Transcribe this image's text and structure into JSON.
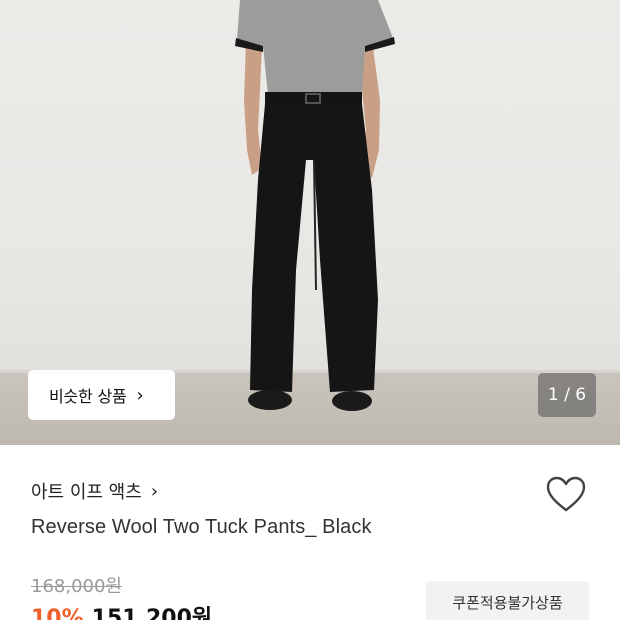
{
  "gallery": {
    "similar_button_label": "비슷한 상품",
    "page_indicator": "1 / 6"
  },
  "product": {
    "brand": "아트 이프 액츠",
    "name": "Reverse Wool Two Tuck Pants_ Black",
    "original_price": "168,000원",
    "discount": "10%",
    "sale_price": "151,200원",
    "coupon_note": "쿠폰적용불가상품"
  },
  "icons": {
    "brand_chevron": "chevron-right-icon",
    "similar_chevron": "chevron-right-icon",
    "wishlist": "heart-outline-icon"
  },
  "colors": {
    "discount": "#f0602d",
    "badge_bg": "#f2f2f2"
  }
}
